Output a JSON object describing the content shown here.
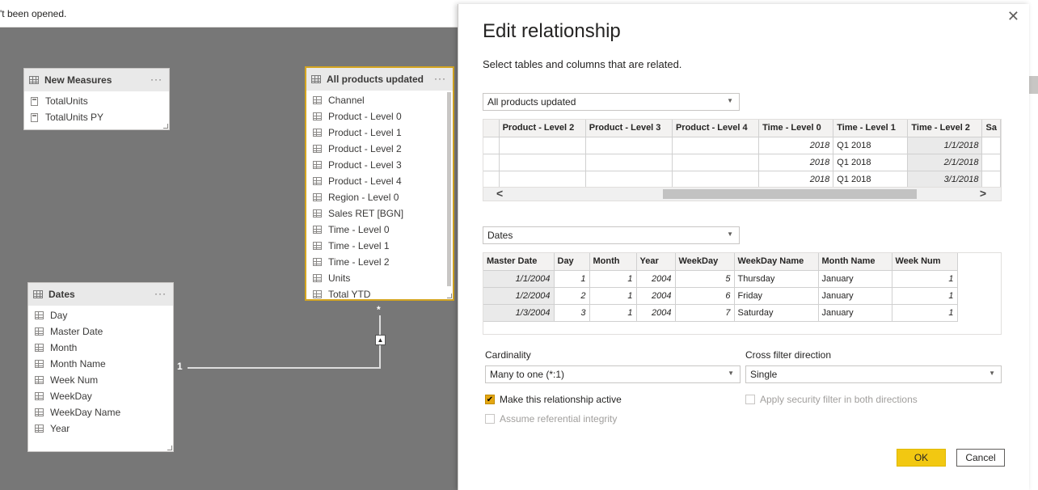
{
  "notice": "'t been opened.",
  "canvas": {
    "new_measures": {
      "title": "New Measures",
      "more": "···",
      "fields": [
        "TotalUnits",
        "TotalUnits PY"
      ]
    },
    "all_products": {
      "title": "All products updated",
      "more": "···",
      "fields": [
        "Channel",
        "Product - Level 0",
        "Product - Level 1",
        "Product - Level 2",
        "Product - Level 3",
        "Product - Level 4",
        "Region - Level 0",
        "Sales RET [BGN]",
        "Time - Level 0",
        "Time - Level 1",
        "Time - Level 2",
        "Units",
        "Total YTD"
      ]
    },
    "dates": {
      "title": "Dates",
      "more": "···",
      "fields": [
        "Day",
        "Master Date",
        "Month",
        "Month Name",
        "Week Num",
        "WeekDay",
        "WeekDay Name",
        "Year"
      ]
    },
    "relationship": {
      "one_label": "1",
      "many_label": "*",
      "arrow": "▲"
    }
  },
  "dialog": {
    "title": "Edit relationship",
    "subtitle": "Select tables and columns that are related.",
    "close_icon": "✕",
    "table1": {
      "selected": "All products updated",
      "headers": [
        "Product - Level 2",
        "Product - Level 3",
        "Product - Level 4",
        "Time - Level 0",
        "Time - Level 1",
        "Time - Level 2",
        "Sa"
      ],
      "rows": [
        [
          "",
          "",
          "",
          "2018",
          "Q1 2018",
          "1/1/2018",
          ""
        ],
        [
          "",
          "",
          "",
          "2018",
          "Q1 2018",
          "2/1/2018",
          ""
        ],
        [
          "",
          "",
          "",
          "2018",
          "Q1 2018",
          "3/1/2018",
          ""
        ]
      ]
    },
    "table2": {
      "selected": "Dates",
      "headers": [
        "Master Date",
        "Day",
        "Month",
        "Year",
        "WeekDay",
        "WeekDay Name",
        "Month Name",
        "Week Num"
      ],
      "rows": [
        [
          "1/1/2004",
          "1",
          "1",
          "2004",
          "5",
          "Thursday",
          "January",
          "1"
        ],
        [
          "1/2/2004",
          "2",
          "1",
          "2004",
          "6",
          "Friday",
          "January",
          "1"
        ],
        [
          "1/3/2004",
          "3",
          "1",
          "2004",
          "7",
          "Saturday",
          "January",
          "1"
        ]
      ]
    },
    "cardinality": {
      "label": "Cardinality",
      "value": "Many to one (*:1)"
    },
    "cross_filter": {
      "label": "Cross filter direction",
      "value": "Single"
    },
    "options": {
      "active": {
        "label": "Make this relationship active",
        "checked": true
      },
      "security": {
        "label": "Apply security filter in both directions",
        "checked": false
      },
      "integrity": {
        "label": "Assume referential integrity",
        "checked": false
      }
    },
    "ok_label": "OK",
    "cancel_label": "Cancel",
    "colors": {
      "accent": "#F2C811",
      "selected_table_border": "#D4A520"
    }
  }
}
